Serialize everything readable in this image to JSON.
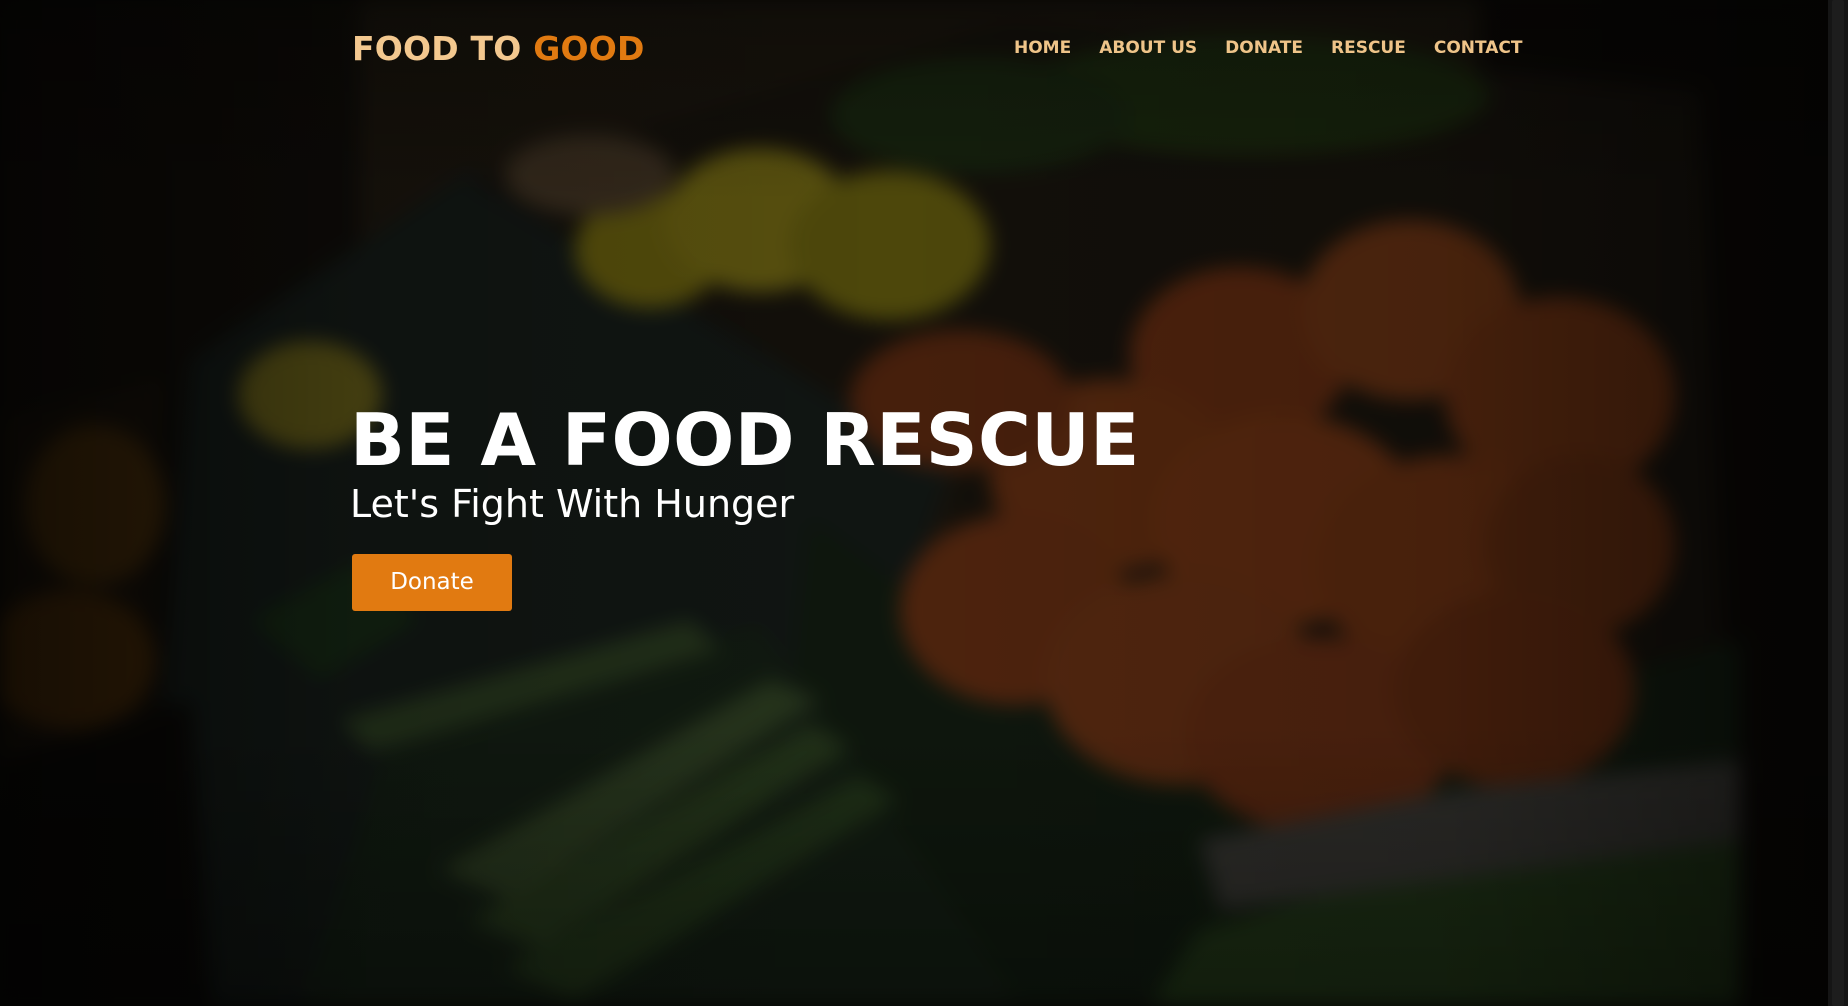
{
  "brand": {
    "text_primary": "FOOD TO ",
    "text_accent": "GOOD",
    "primary_color": "#f3c88f",
    "accent_color": "#e17a11"
  },
  "navigation": {
    "items": [
      {
        "label": "HOME"
      },
      {
        "label": "ABOUT US"
      },
      {
        "label": "DONATE"
      },
      {
        "label": "RESCUE"
      },
      {
        "label": "CONTACT"
      }
    ]
  },
  "hero": {
    "title": "BE A FOOD RESCUE",
    "subtitle": "Let's Fight With Hunger",
    "button_label": "Donate"
  },
  "colors": {
    "button_background": "#e17a11",
    "hero_text": "#ffffff"
  }
}
